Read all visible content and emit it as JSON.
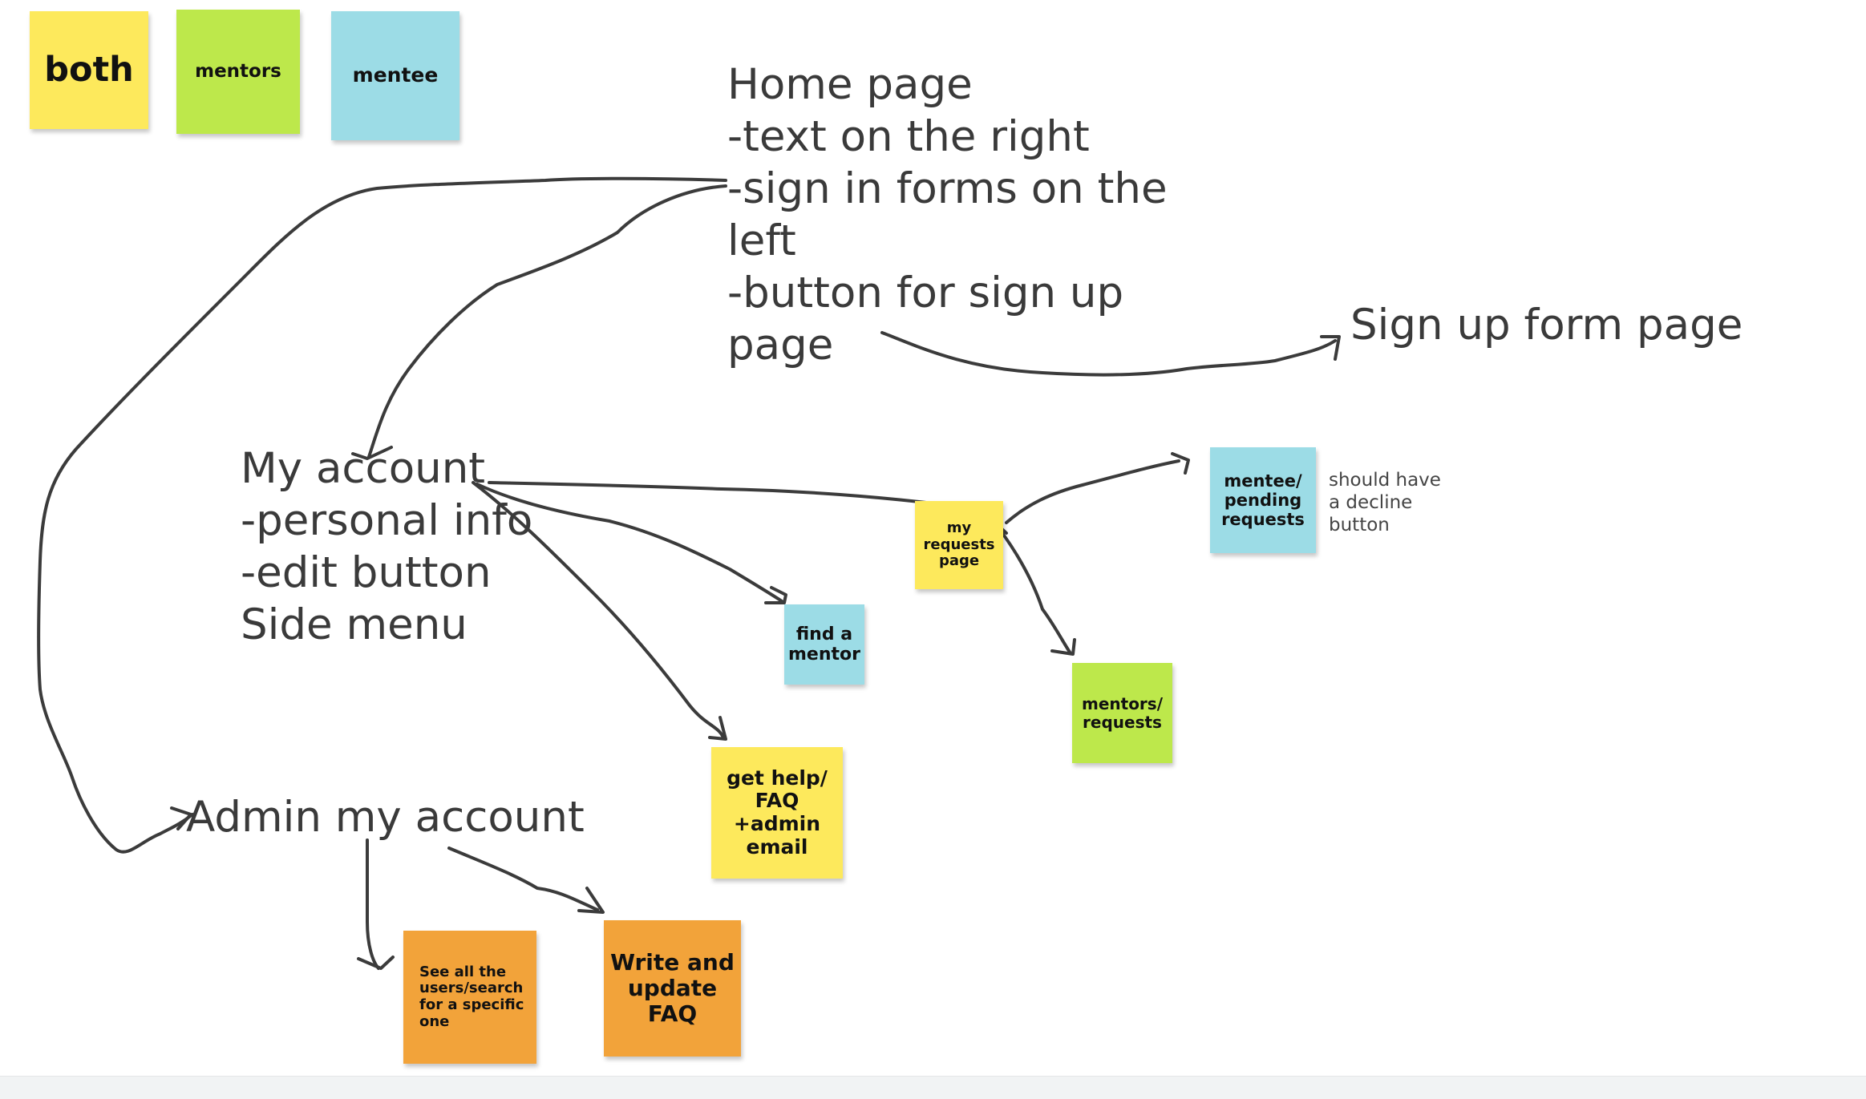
{
  "legend": {
    "both": "both",
    "mentors": "mentors",
    "mentee": "mentee"
  },
  "notes": {
    "home_page": "Home page\n-text on the right\n-sign in forms on the\nleft\n-button for sign up\npage",
    "sign_up_form": "Sign up form page",
    "my_account": "My account\n-personal info\n-edit button\nSide menu",
    "admin_my_account": "Admin my account",
    "decline_note": "should have\na decline\nbutton"
  },
  "stickies": {
    "my_requests_page": "my\nrequests\npage",
    "mentee_pending_requests": "mentee/\npending\nrequests",
    "find_a_mentor": "find a\nmentor",
    "mentors_requests": "mentors/\nrequests",
    "get_help_faq": "get help/\nFAQ\n+admin\nemail",
    "see_all_users": "See all the\nusers/search\nfor a specific\none",
    "write_update_faq": "Write and\nupdate\nFAQ"
  },
  "colors": {
    "both": "#fde95c",
    "mentors": "#bde84b",
    "mentee": "#9cdce6",
    "admin": "#f2a33a",
    "stroke": "#3b3b3b"
  }
}
